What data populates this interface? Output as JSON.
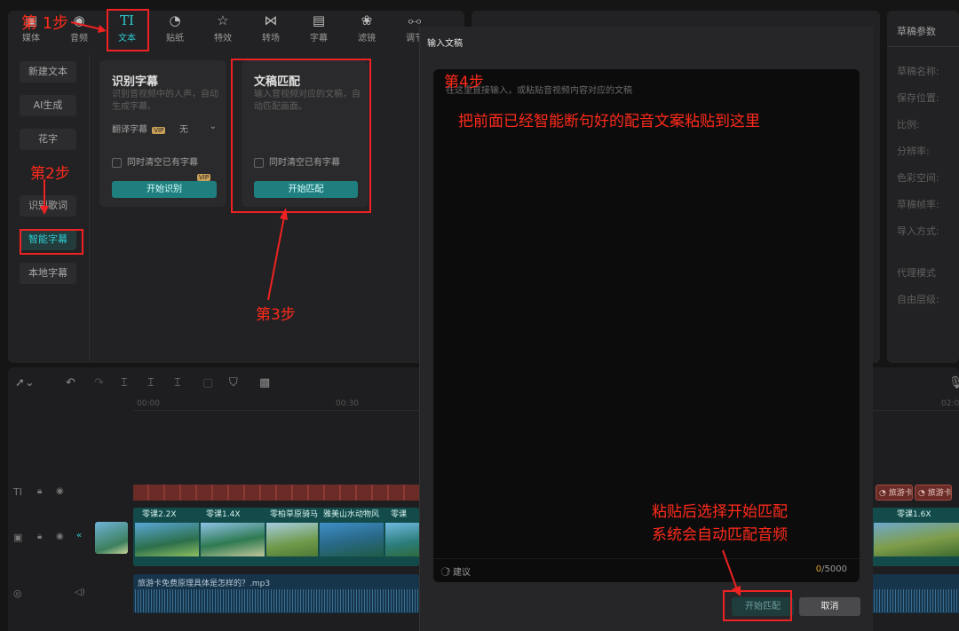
{
  "toolbar": {
    "items": [
      {
        "label": "媒体",
        "icon": "media-icon"
      },
      {
        "label": "音频",
        "icon": "audio-icon"
      },
      {
        "label": "文本",
        "icon": "text-icon",
        "active": true
      },
      {
        "label": "贴纸",
        "icon": "sticker-icon"
      },
      {
        "label": "特效",
        "icon": "effects-icon"
      },
      {
        "label": "转场",
        "icon": "transition-icon"
      },
      {
        "label": "字幕",
        "icon": "caption-icon"
      },
      {
        "label": "滤镜",
        "icon": "filter-icon"
      },
      {
        "label": "调节",
        "icon": "adjust-icon"
      }
    ],
    "accent_color": "#2ccad0"
  },
  "sidebar": {
    "items": [
      {
        "label": "新建文本"
      },
      {
        "label": "AI生成"
      },
      {
        "label": "花字"
      },
      {
        "label": "识别歌词"
      },
      {
        "label": "智能字幕",
        "selected": true
      },
      {
        "label": "本地字幕"
      }
    ]
  },
  "cards": {
    "recognize": {
      "title": "识别字幕",
      "desc": "识别音视频中的人声，自动生成字幕。",
      "translate_label": "翻译字幕",
      "translate_badge": "VIP",
      "translate_value": "无",
      "clear_label": "同时清空已有字幕",
      "start_button": "开始识别",
      "vip_badge": "VIP"
    },
    "match": {
      "title": "文稿匹配",
      "desc": "输入音视频对应的文稿，自动匹配画面。",
      "clear_label": "同时清空已有字幕",
      "start_button": "开始匹配"
    }
  },
  "right_panel": {
    "title": "草稿参数",
    "params": [
      "草稿名称:",
      "保存位置:",
      "比例:",
      "分辨率:",
      "色彩空间:",
      "草稿帧率:",
      "导入方式:",
      "代理模式",
      "自由层级:"
    ]
  },
  "timeline": {
    "ticks": [
      "00:00",
      "00:30",
      "02:0"
    ],
    "caption_clips": [
      "旅游卡",
      "旅游卡"
    ],
    "video_clips": [
      "零课2.2X",
      "零课1.4X",
      "零柏草原骑马",
      "雅美山水动物风",
      "零课",
      "零课1.6X"
    ],
    "audio_label": "旅游卡免费原理具体是怎样的？.mp3",
    "icons": [
      "select-tool-icon",
      "undo-icon",
      "redo-icon",
      "split-icon",
      "split-left-icon",
      "split-right-icon",
      "delete-icon",
      "marker-icon",
      "screenshot-icon"
    ]
  },
  "modal": {
    "title": "输入文稿",
    "placeholder": "在这里直接输入，或粘贴音视频内容对应的文稿",
    "suggest_label": "建议",
    "count_current": "0",
    "count_total": "/5000",
    "start_button": "开始匹配",
    "cancel_button": "取消"
  },
  "annotations": {
    "step1": "第 1步",
    "step2": "第2步",
    "step3": "第3步",
    "step4": "第4步",
    "paste_hint": "把前面已经智能断句好的配音文案粘贴到这里",
    "match_hint_line1": "粘贴后选择开始匹配",
    "match_hint_line2": "系统会自动匹配音频",
    "color": "#ff2a1a"
  }
}
